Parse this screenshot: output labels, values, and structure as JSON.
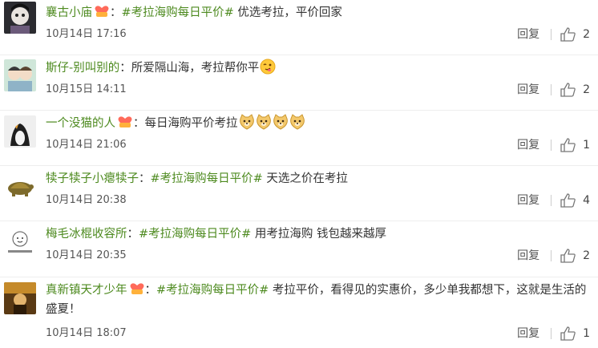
{
  "comments": [
    {
      "user": "襄古小庙",
      "has_badge": true,
      "topic": "#考拉海购每日平价#",
      "text": " 优选考拉，平价回家",
      "emoji_count": 0,
      "time": "10月14日 17:16",
      "reply": "回复",
      "likes": "2"
    },
    {
      "user": "斯仔-别叫别的",
      "has_badge": false,
      "topic": "",
      "text": "所爱隔山海，考拉帮你平",
      "emoji_count": 1,
      "time": "10月15日 14:11",
      "reply": "回复",
      "likes": "2"
    },
    {
      "user": "一个没猫的人",
      "has_badge": true,
      "topic": "",
      "text": "每日海购平价考拉",
      "emoji_count": 4,
      "time": "10月14日 21:06",
      "reply": "回复",
      "likes": "1"
    },
    {
      "user": "犊子犊子小瘪犊子",
      "has_badge": false,
      "topic": "#考拉海购每日平价#",
      "text": " 天选之价在考拉",
      "emoji_count": 0,
      "time": "10月14日 20:38",
      "reply": "回复",
      "likes": "4"
    },
    {
      "user": "梅毛冰棍收容所",
      "has_badge": false,
      "topic": "#考拉海购每日平价#",
      "text": " 用考拉海购 钱包越来越厚",
      "emoji_count": 0,
      "time": "10月14日 20:35",
      "reply": "回复",
      "likes": "2"
    },
    {
      "user": "真新镇天才少年",
      "has_badge": true,
      "topic": "#考拉海购每日平价#",
      "text": " 考拉平价，看得见的实惠价，多少单我都想下，这就是生活的盛夏！",
      "emoji_count": 0,
      "time": "10月14日 18:07",
      "reply": "回复",
      "likes": "1"
    }
  ],
  "colors": {
    "link": "#4d8a1f",
    "text": "#333333",
    "meta": "#555555",
    "divider": "#eeeeee"
  }
}
